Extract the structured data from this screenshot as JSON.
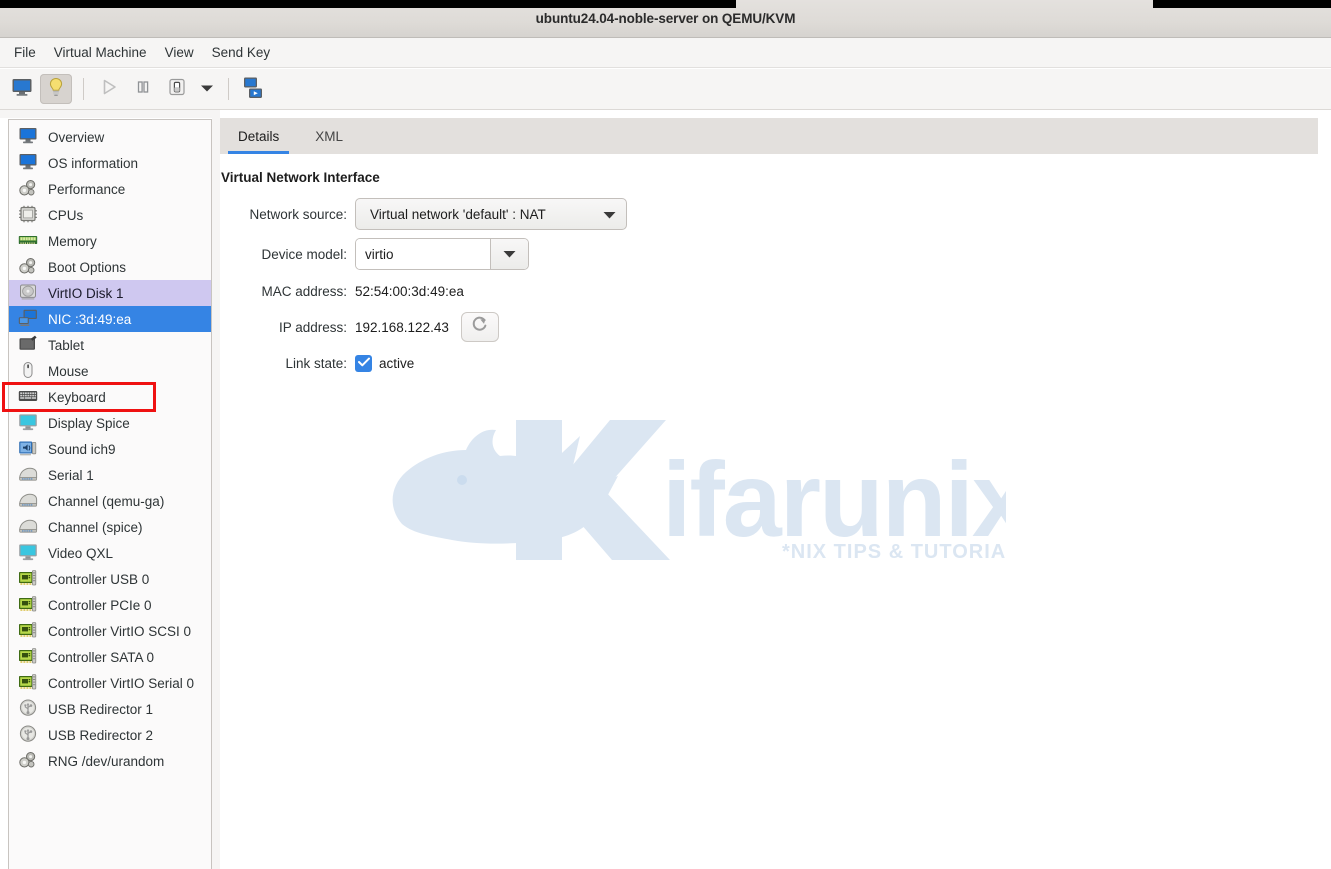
{
  "window": {
    "title": "ubuntu24.04-noble-server on QEMU/KVM"
  },
  "menubar": {
    "items": [
      {
        "label": "File"
      },
      {
        "label": "Virtual Machine"
      },
      {
        "label": "View"
      },
      {
        "label": "Send Key"
      }
    ]
  },
  "toolbar": {
    "buttons": [
      {
        "name": "show-console-button",
        "icon": "monitor-icon",
        "active": false
      },
      {
        "name": "show-details-button",
        "icon": "lightbulb-icon",
        "active": true
      },
      {
        "name": "run-button",
        "icon": "play-icon",
        "active": false
      },
      {
        "name": "pause-button",
        "icon": "pause-icon",
        "active": false
      },
      {
        "name": "shutdown-button",
        "icon": "power-switch-icon",
        "active": false
      },
      {
        "name": "shutdown-menu-button",
        "icon": "chevron-down-icon",
        "active": false
      },
      {
        "name": "snapshots-button",
        "icon": "screens-icon",
        "active": false
      }
    ]
  },
  "sidebar": {
    "items": [
      {
        "label": "Overview",
        "icon": "monitor-icon",
        "state": "normal"
      },
      {
        "label": "OS information",
        "icon": "monitor-icon",
        "state": "normal"
      },
      {
        "label": "Performance",
        "icon": "gears-icon",
        "state": "normal"
      },
      {
        "label": "CPUs",
        "icon": "cpu-chip-icon",
        "state": "normal"
      },
      {
        "label": "Memory",
        "icon": "memory-stick-icon",
        "state": "normal"
      },
      {
        "label": "Boot Options",
        "icon": "gears-icon",
        "state": "normal"
      },
      {
        "label": "VirtIO Disk 1",
        "icon": "hard-disk-icon",
        "state": "hovered"
      },
      {
        "label": "NIC :3d:49:ea",
        "icon": "network-card-icon",
        "state": "selected"
      },
      {
        "label": "Tablet",
        "icon": "tablet-icon",
        "state": "normal"
      },
      {
        "label": "Mouse",
        "icon": "mouse-icon",
        "state": "normal"
      },
      {
        "label": "Keyboard",
        "icon": "keyboard-icon",
        "state": "normal"
      },
      {
        "label": "Display Spice",
        "icon": "display-icon",
        "state": "normal"
      },
      {
        "label": "Sound ich9",
        "icon": "sound-card-icon",
        "state": "normal"
      },
      {
        "label": "Serial 1",
        "icon": "serial-port-icon",
        "state": "normal"
      },
      {
        "label": "Channel (qemu-ga)",
        "icon": "serial-port-icon",
        "state": "normal"
      },
      {
        "label": "Channel (spice)",
        "icon": "serial-port-icon",
        "state": "normal"
      },
      {
        "label": "Video QXL",
        "icon": "display-icon",
        "state": "normal"
      },
      {
        "label": "Controller USB 0",
        "icon": "expansion-card-icon",
        "state": "normal"
      },
      {
        "label": "Controller PCIe 0",
        "icon": "expansion-card-icon",
        "state": "normal"
      },
      {
        "label": "Controller VirtIO SCSI 0",
        "icon": "expansion-card-icon",
        "state": "normal"
      },
      {
        "label": "Controller SATA 0",
        "icon": "expansion-card-icon",
        "state": "normal"
      },
      {
        "label": "Controller VirtIO Serial 0",
        "icon": "expansion-card-icon",
        "state": "normal"
      },
      {
        "label": "USB Redirector 1",
        "icon": "usb-icon",
        "state": "normal"
      },
      {
        "label": "USB Redirector 2",
        "icon": "usb-icon",
        "state": "normal"
      },
      {
        "label": "RNG /dev/urandom",
        "icon": "gears-icon",
        "state": "normal"
      }
    ]
  },
  "tabs": [
    {
      "label": "Details",
      "active": true
    },
    {
      "label": "XML",
      "active": false
    }
  ],
  "details": {
    "heading": "Virtual Network Interface",
    "network_source": {
      "label": "Network source:",
      "value": "Virtual network 'default' : NAT"
    },
    "device_model": {
      "label": "Device model:",
      "value": "virtio"
    },
    "mac_address": {
      "label": "MAC address:",
      "value": "52:54:00:3d:49:ea"
    },
    "ip_address": {
      "label": "IP address:",
      "value": "192.168.122.43",
      "refresh_tooltip": "refresh-icon"
    },
    "link_state": {
      "label": "Link state:",
      "checkbox_label": "active",
      "checked": true
    }
  },
  "watermark": {
    "brand": "Kifarunix",
    "tagline": "*NIX TIPS & TUTORIALS",
    "color": "#dbe6f2"
  },
  "annotation": {
    "highlight_target": "VirtIO Disk 1",
    "box_color": "#ef1111"
  },
  "colors": {
    "accent": "#3584e4",
    "selected_row": "#3584e4",
    "hover_row": "#cfc8f0",
    "chrome": "#f6f5f4",
    "titlebar": "#dedbd7"
  }
}
